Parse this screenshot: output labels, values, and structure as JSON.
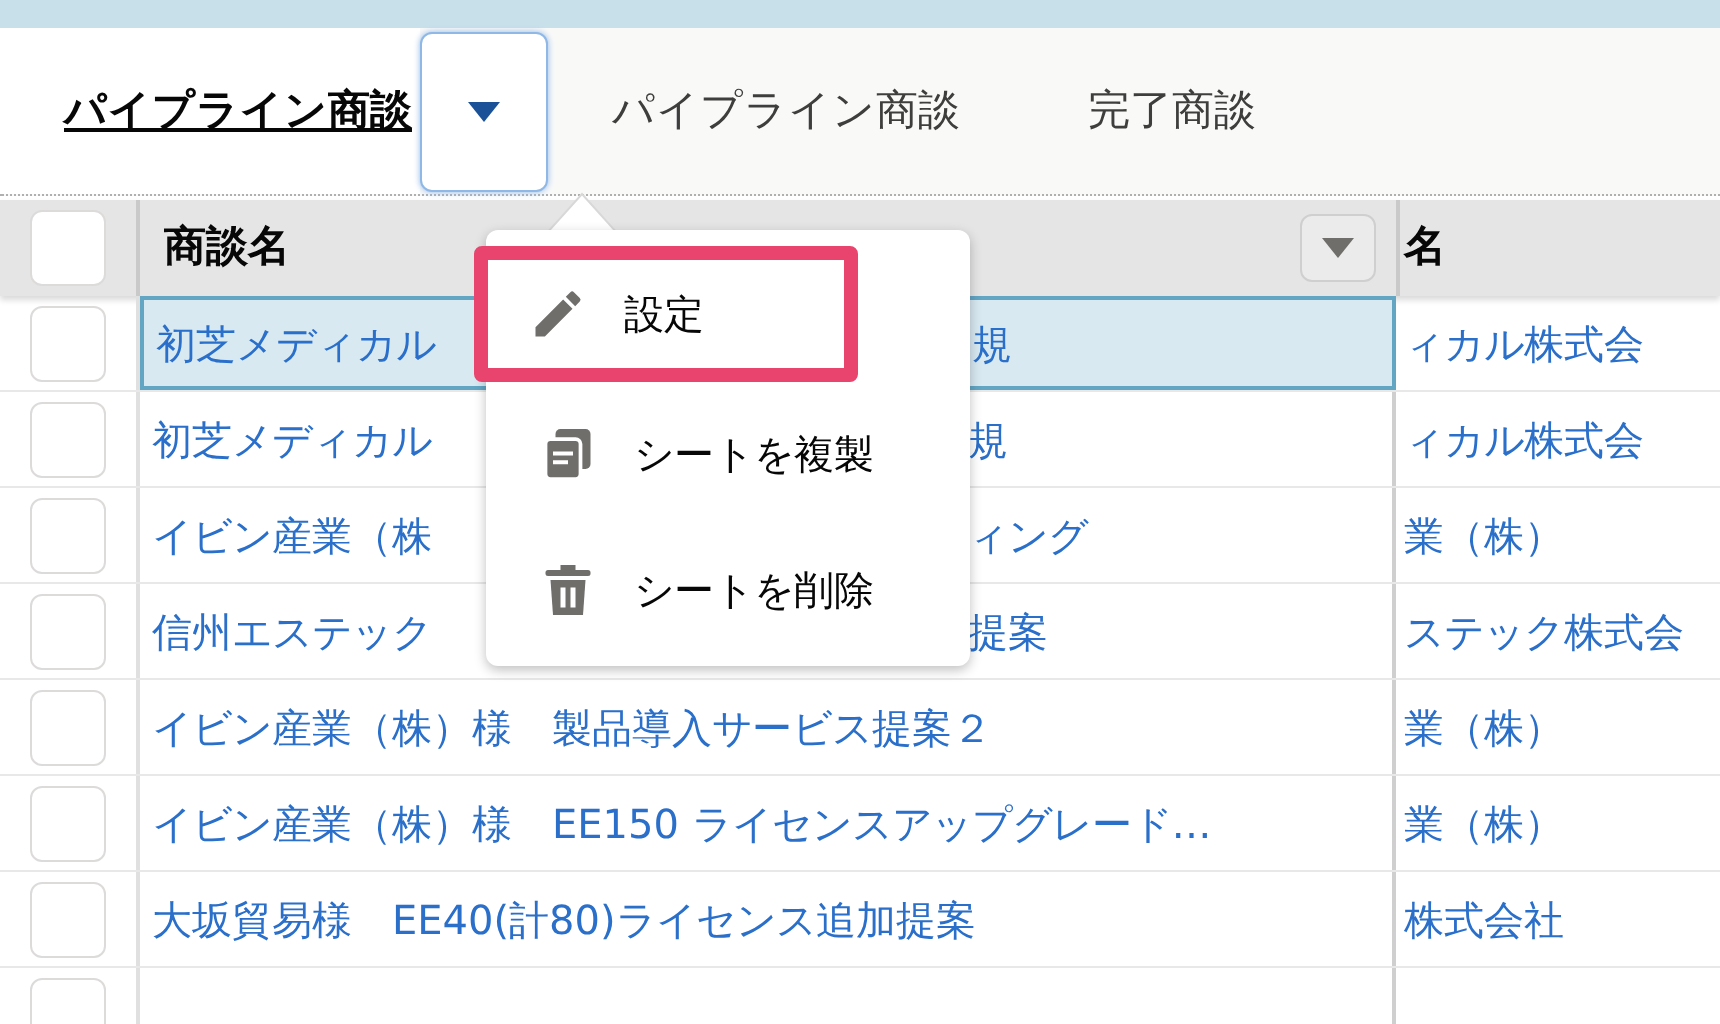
{
  "tabs": [
    {
      "label": "パイプライン商談",
      "selected": true,
      "kind": "main"
    },
    {
      "label": "パイプライン商談",
      "selected": false,
      "kind": "plain"
    },
    {
      "label": "完了商談",
      "selected": false,
      "kind": "plain"
    }
  ],
  "menu": {
    "expanded": true,
    "items": [
      {
        "label": "設定",
        "kind": "pencil",
        "highlighted": true
      },
      {
        "label": "シートを複製",
        "kind": "copy",
        "highlighted": false
      },
      {
        "label": "シートを削除",
        "kind": "trash",
        "highlighted": false
      }
    ]
  },
  "table": {
    "all_checked": false,
    "columns": [
      "商談名",
      "名"
    ],
    "rows": [
      {
        "selected": true,
        "checked": false,
        "name_start": "初芝メディカル",
        "name_end": "規",
        "column_3": "ィカル株式会"
      },
      {
        "selected": false,
        "checked": false,
        "name_start": "初芝メディカル",
        "name_end": "規",
        "column_3": "ィカル株式会"
      },
      {
        "selected": false,
        "checked": false,
        "name_start": "イビン産業（株",
        "name_end": "ィング",
        "column_3": "業（株）"
      },
      {
        "selected": false,
        "checked": false,
        "name_start": "信州エステック",
        "name_end": "提案",
        "column_3": "ステック株式会"
      },
      {
        "selected": false,
        "checked": false,
        "name": "イビン産業（株）様　製品導入サービス提案２",
        "column_3": "業（株）"
      },
      {
        "selected": false,
        "checked": false,
        "name": "イビン産業（株）様　EE150 ライセンスアップグレード…",
        "column_3": "業（株）"
      },
      {
        "selected": false,
        "checked": false,
        "name": "大坂貿易様　EE40(計80)ライセンス追加提案",
        "column_3": "株式会社"
      },
      {
        "selected": false,
        "checked": false
      }
    ]
  }
}
